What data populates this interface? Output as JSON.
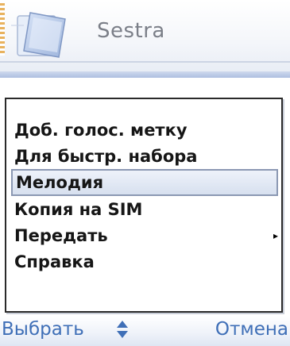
{
  "header": {
    "title": "Sestra",
    "icon": "contact-card-icon"
  },
  "menu": {
    "items": [
      {
        "label": "Доб. голос. метку"
      },
      {
        "label": "Для быстр. набора"
      },
      {
        "label": "Мелодия",
        "selected": true
      },
      {
        "label": "Копия на SIM"
      },
      {
        "label": "Передать",
        "submenu_icon": "submenu-arrow-icon",
        "arrow": "▸"
      },
      {
        "label": "Справка"
      }
    ]
  },
  "softkeys": {
    "left": "Выбрать",
    "right": "Отмена",
    "center_icon": "scroll-updown-icon"
  },
  "colors": {
    "softkey_text": "#3f6fb7",
    "selection_bg": "#dce4f1",
    "selection_border": "#8b98b3",
    "menu_border": "#2a2a2a"
  }
}
